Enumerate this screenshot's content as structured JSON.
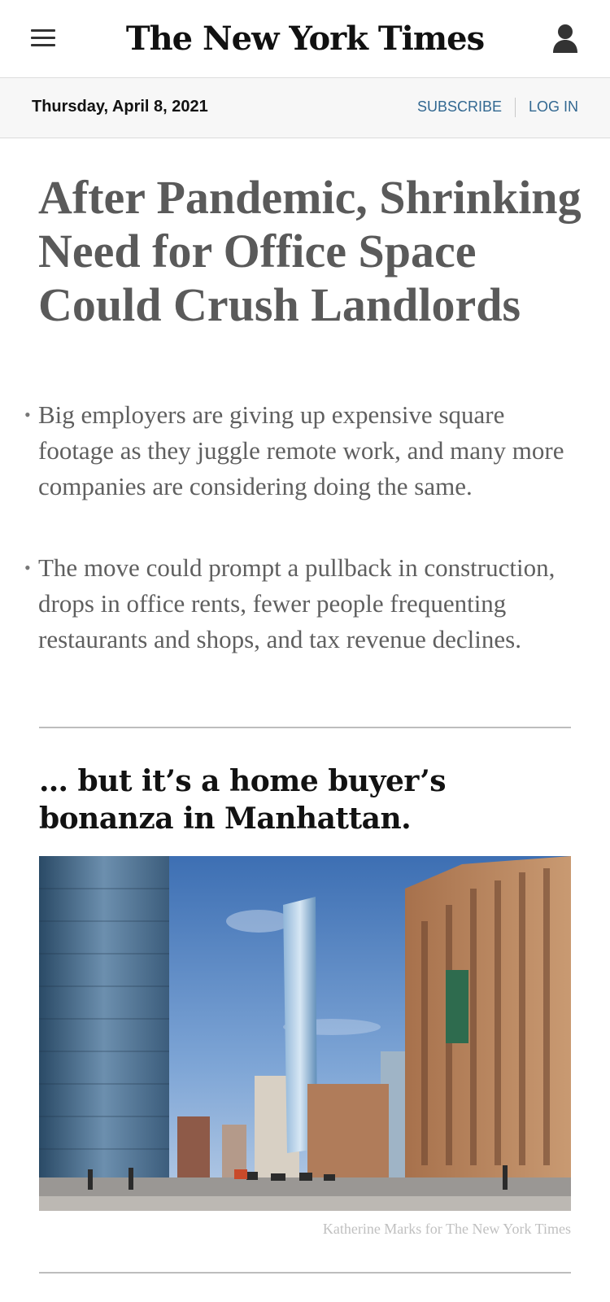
{
  "header": {
    "logo": "The New York Times",
    "menu_icon": "hamburger-menu-icon",
    "account_icon": "user-account-icon"
  },
  "datebar": {
    "date": "Thursday, April 8, 2021",
    "subscribe_label": "SUBSCRIBE",
    "login_label": "LOG IN",
    "link_color": "#326891"
  },
  "article": {
    "headline": "After Pandemic, Shrinking Need for Office Space Could Crush Landlords",
    "summary": [
      "Big employers are giving up expensive square footage as they juggle remote work, and many more companies are considering doing the same.",
      "The move could prompt a pullback in construction, drops in office rents, fewer people frequenting restaurants and shops, and tax revenue declines."
    ]
  },
  "next_story": {
    "headline": "… but it’s a home buyer’s bonanza in Manhattan.",
    "photo_credit": "Katherine Marks for The New York Times"
  }
}
